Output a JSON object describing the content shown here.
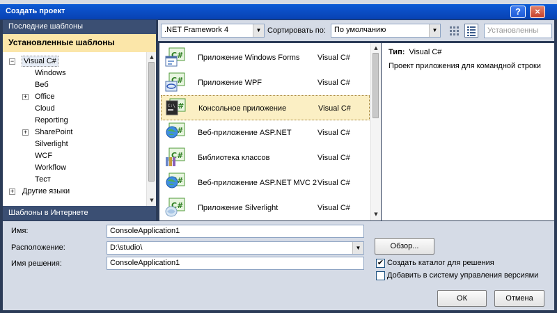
{
  "window": {
    "title": "Создать проект",
    "help_label": "?",
    "close_label": "×"
  },
  "left_pane": {
    "recent_header": "Последние шаблоны",
    "installed_header": "Установленные шаблоны",
    "online_header": "Шаблоны в Интернете",
    "tree": [
      {
        "label": "Visual C#",
        "expander": "−"
      },
      {
        "label": "Windows",
        "expander": ""
      },
      {
        "label": "Веб",
        "expander": ""
      },
      {
        "label": "Office",
        "expander": "+"
      },
      {
        "label": "Cloud",
        "expander": ""
      },
      {
        "label": "Reporting",
        "expander": ""
      },
      {
        "label": "SharePoint",
        "expander": "+"
      },
      {
        "label": "Silverlight",
        "expander": ""
      },
      {
        "label": "WCF",
        "expander": ""
      },
      {
        "label": "Workflow",
        "expander": ""
      },
      {
        "label": "Тест",
        "expander": ""
      },
      {
        "label": "Другие языки",
        "expander": "+"
      }
    ]
  },
  "toolbar": {
    "framework_value": ".NET Framework 4",
    "sort_label": "Сортировать по:",
    "sort_value": "По умолчанию",
    "search_placeholder": "Установленны"
  },
  "templates": [
    {
      "name": "Приложение Windows Forms",
      "lang": "Visual C#",
      "icon": "windows-forms-icon"
    },
    {
      "name": "Приложение WPF",
      "lang": "Visual C#",
      "icon": "wpf-icon"
    },
    {
      "name": "Консольное приложение",
      "lang": "Visual C#",
      "icon": "console-icon"
    },
    {
      "name": "Веб-приложение ASP.NET",
      "lang": "Visual C#",
      "icon": "aspnet-icon"
    },
    {
      "name": "Библиотека классов",
      "lang": "Visual C#",
      "icon": "class-library-icon"
    },
    {
      "name": "Веб-приложение ASP.NET MVC 2",
      "lang": "Visual C#",
      "icon": "aspnet-mvc-icon"
    },
    {
      "name": "Приложение Silverlight",
      "lang": "Visual C#",
      "icon": "silverlight-icon"
    }
  ],
  "selected_template_index": 2,
  "description": {
    "type_label": "Тип:",
    "type_value": "Visual C#",
    "text": "Проект приложения для командной строки"
  },
  "form": {
    "name_label": "Имя:",
    "name_value": "ConsoleApplication1",
    "location_label": "Расположение:",
    "location_value": "D:\\studio\\",
    "solution_label": "Имя решения:",
    "solution_value": "ConsoleApplication1",
    "browse_label": "Обзор...",
    "create_dir_label": "Создать каталог для решения",
    "create_dir_checked": true,
    "add_vcs_label": "Добавить в систему управления версиями",
    "add_vcs_checked": false
  },
  "buttons": {
    "ok": "ОК",
    "cancel": "Отмена"
  },
  "colors": {
    "frame": "#2b3b57",
    "panel": "#d5dbe6",
    "header_dark": "#3b4f73",
    "header_selected": "#fbe6a9",
    "selection": "#fbefc4",
    "title_blue": "#0b4fc7"
  }
}
